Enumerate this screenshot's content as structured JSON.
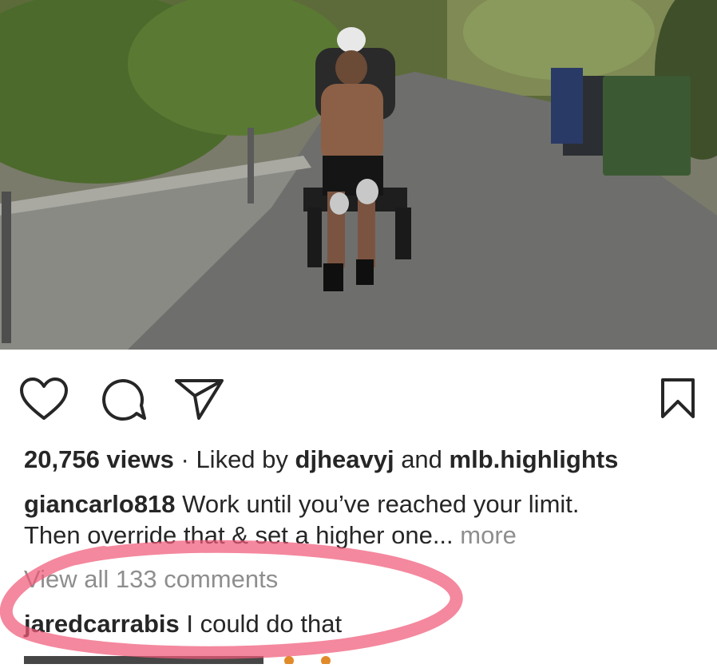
{
  "post": {
    "media_alt": "video",
    "actions": {
      "like_icon": "heart-outline-icon",
      "comment_icon": "comment-bubble-icon",
      "share_icon": "paper-plane-icon",
      "save_icon": "bookmark-icon"
    },
    "views": "20,756 views",
    "separator": " · Liked by ",
    "liked_by_1": "djheavyj",
    "liked_and": " and ",
    "liked_by_2": "mlb.highlights",
    "caption": {
      "username": "giancarlo818",
      "text_line1": " Work until you’ve reached your limit.",
      "text_line2": "Then override that & set a higher one...",
      "more": " more"
    },
    "view_all_comments": "View all 133 comments",
    "comments": [
      {
        "username": "jaredcarrabis",
        "text": " I could do that"
      }
    ]
  },
  "annotation": {
    "color": "#f05a78"
  }
}
